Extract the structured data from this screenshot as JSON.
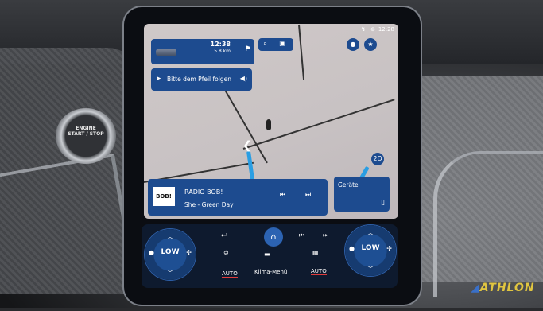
{
  "engine_button": {
    "line1": "ENGINE",
    "line2": "START / STOP"
  },
  "brand_logo": "ATHLON",
  "status_bar": {
    "time": "12:28",
    "icons": "↯ ⊕"
  },
  "navigation": {
    "arrival_time": "12:38",
    "distance": "5.8 km",
    "instruction": "Bitte dem Pfeil folgen"
  },
  "map": {
    "scale_hint": ""
  },
  "radio": {
    "station_logo": "BOB!",
    "station": "RADIO BOB!",
    "now_playing": "She - Green Day"
  },
  "devices_card": {
    "label": "Geräte"
  },
  "climate": {
    "left_dial": "LOW",
    "right_dial": "LOW",
    "auto_left": "AUTO",
    "auto_right": "AUTO",
    "menu": "Klima-Menü"
  },
  "colors": {
    "card_blue": "#1d4b8f",
    "route_blue": "#2a9ee3",
    "auto_underline": "#e03b3b"
  }
}
